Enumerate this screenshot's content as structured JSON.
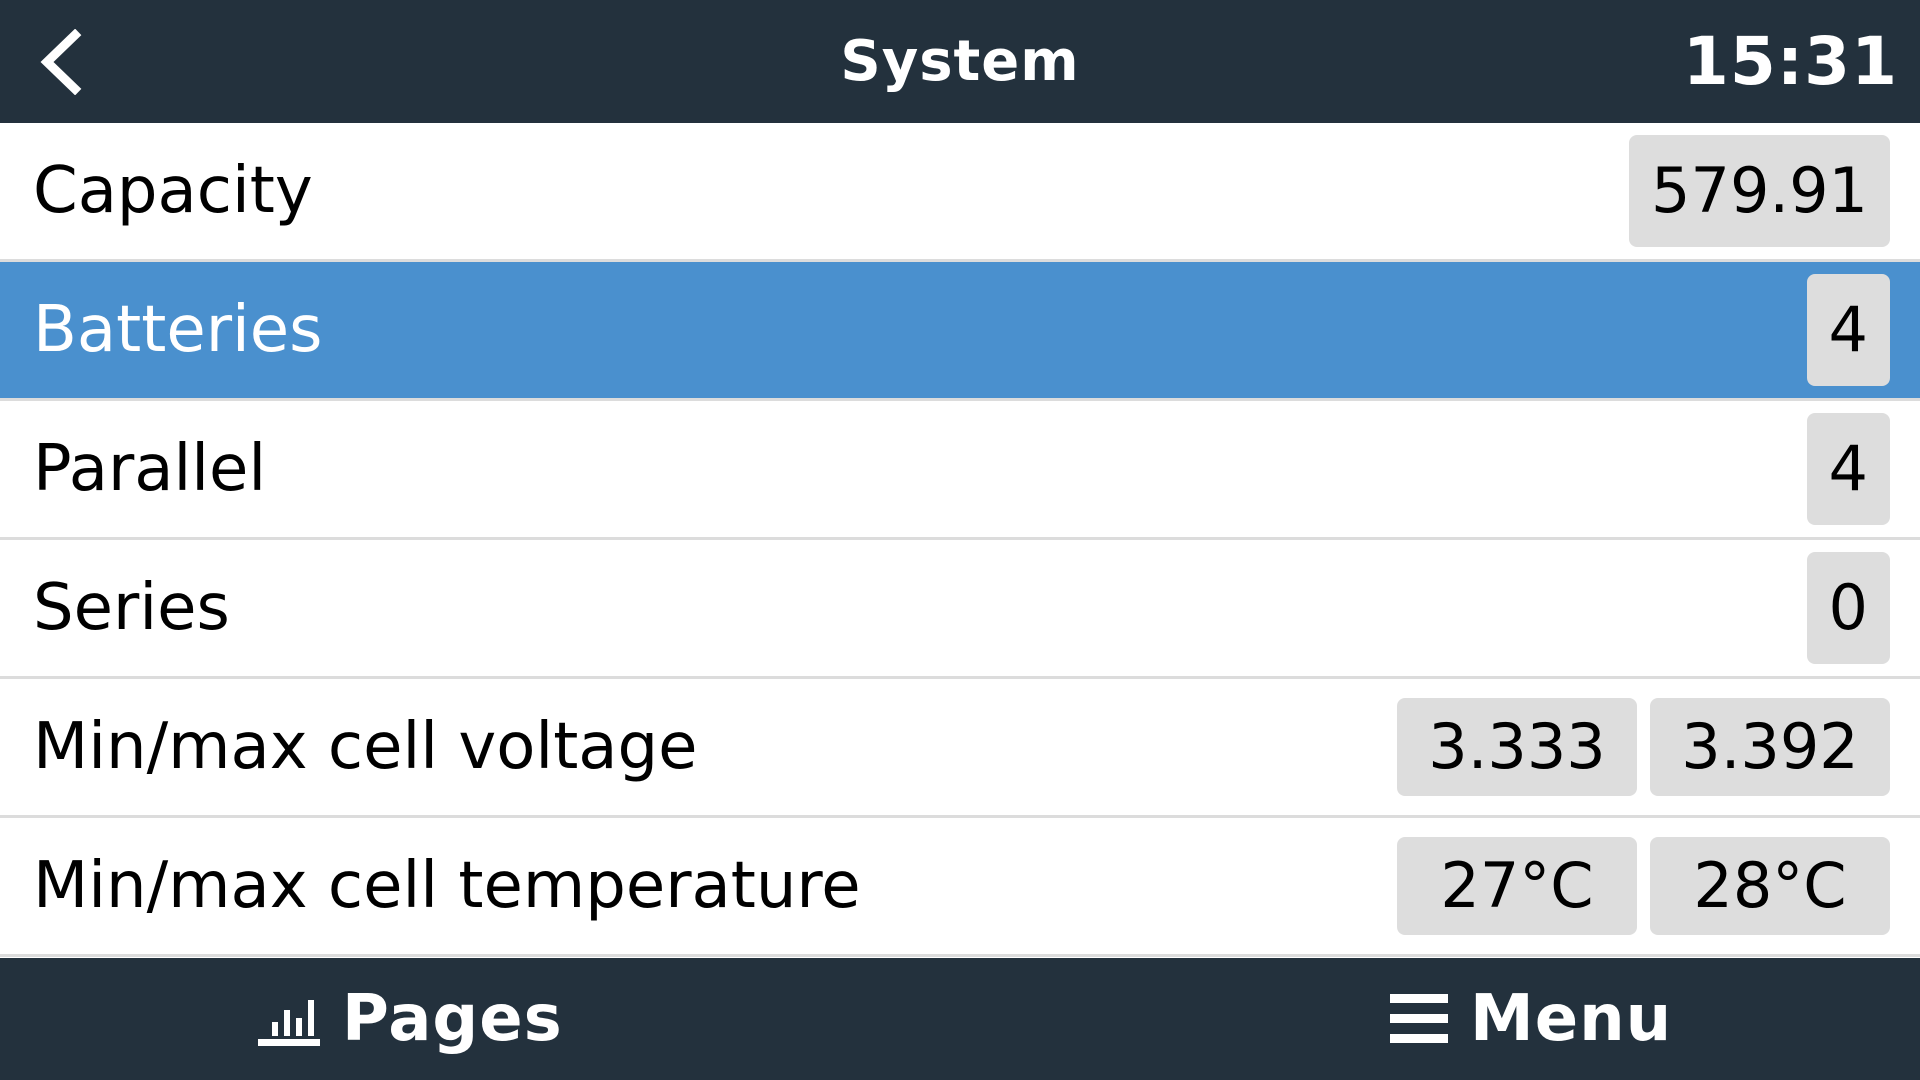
{
  "header": {
    "title": "System",
    "time": "15:31"
  },
  "rows": [
    {
      "label": "Capacity",
      "values": [
        "579.91"
      ]
    },
    {
      "label": "Batteries",
      "values": [
        "4"
      ],
      "selected": true
    },
    {
      "label": "Parallel",
      "values": [
        "4"
      ]
    },
    {
      "label": "Series",
      "values": [
        "0"
      ]
    },
    {
      "label": "Min/max cell voltage",
      "values": [
        "3.333",
        "3.392"
      ]
    },
    {
      "label": "Min/max cell temperature",
      "values": [
        "27°C",
        "28°C"
      ]
    }
  ],
  "footer": {
    "pages_label": "Pages",
    "menu_label": "Menu"
  },
  "colors": {
    "header_bg": "#23313d",
    "selected_bg": "#4a90ce",
    "value_bg": "#dddddd"
  },
  "icons": {
    "back": "chevron-left-icon",
    "pages": "bar-chart-icon",
    "menu": "hamburger-icon"
  }
}
